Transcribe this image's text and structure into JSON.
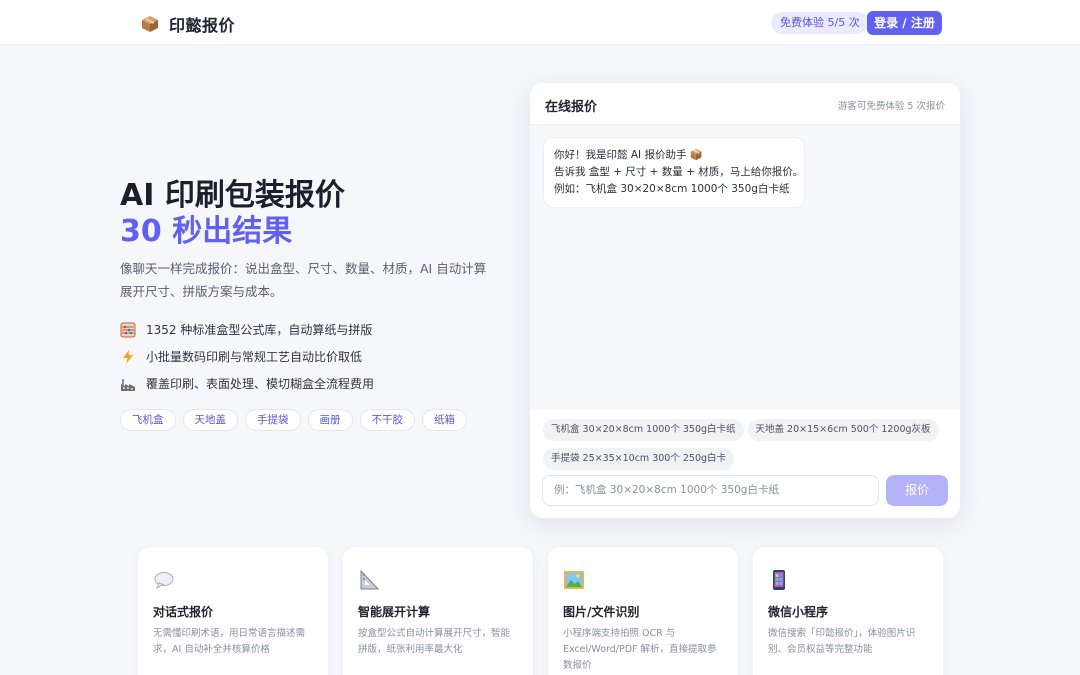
{
  "header": {
    "brand_name": "印懿报价",
    "brand_icon": "package-box-icon",
    "trial_label": "免费体验 5/5 次",
    "login_label": "登录 / 注册"
  },
  "hero": {
    "title": "AI 印刷包装报价",
    "subtitle": "30 秒出结果",
    "description": "像聊天一样完成报价：说出盒型、尺寸、数量、材质，AI 自动计算展开尺寸、拼版方案与成本。",
    "features": [
      {
        "icon": "abacus-icon",
        "text": "1352 种标准盒型公式库，自动算纸与拼版"
      },
      {
        "icon": "lightning-icon",
        "text": "小批量数码印刷与常规工艺自动比价取低"
      },
      {
        "icon": "factory-icon",
        "text": "覆盖印刷、表面处理、模切糊盒全流程费用"
      }
    ],
    "tags": [
      "飞机盒",
      "天地盖",
      "手提袋",
      "画册",
      "不干胶",
      "纸箱"
    ]
  },
  "chat": {
    "title": "在线报价",
    "note": "游客可免费体验 5 次报价",
    "bubble_lines": [
      "你好！我是印懿 AI 报价助手 📦",
      "告诉我 盒型 + 尺寸 + 数量 + 材质，马上给你报价。",
      "例如：飞机盒 30×20×8cm 1000个 350g白卡纸"
    ],
    "suggestions": [
      "飞机盒 30×20×8cm 1000个 350g白卡纸",
      "天地盖 20×15×6cm 500个 1200g灰板",
      "手提袋 25×35×10cm 300个 250g白卡"
    ],
    "input_placeholder": "例：飞机盒 30×20×8cm 1000个 350g白卡纸",
    "submit_label": "报价"
  },
  "cards": [
    {
      "icon": "speech-bubble-icon",
      "title": "对话式报价",
      "desc": "无需懂印刷术语，用日常语言描述需求，AI 自动补全并核算价格"
    },
    {
      "icon": "triangle-ruler-icon",
      "title": "智能展开计算",
      "desc": "按盒型公式自动计算展开尺寸，智能拼版，纸张利用率最大化"
    },
    {
      "icon": "picture-icon",
      "title": "图片/文件识别",
      "desc": "小程序端支持拍照 OCR 与 Excel/Word/PDF 解析，直接提取参数报价"
    },
    {
      "icon": "mobile-phone-icon",
      "title": "微信小程序",
      "desc": "微信搜索「印懿报价」，体验图片识别、会员权益等完整功能"
    }
  ],
  "colors": {
    "accent": "#6160f0",
    "accent_light": "#b3b2f6",
    "background": "#f6f7fb"
  }
}
